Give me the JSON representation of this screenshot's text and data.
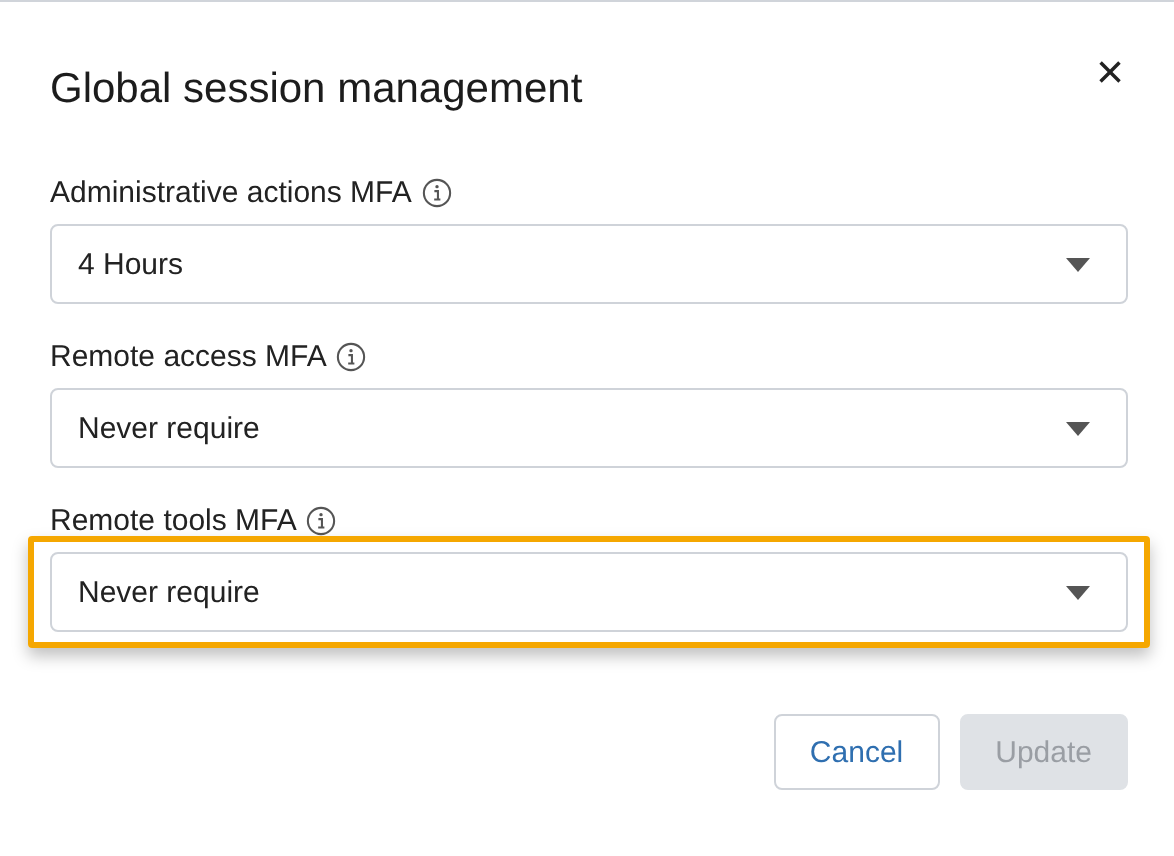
{
  "dialog": {
    "title": "Global session management",
    "close": "×"
  },
  "fields": [
    {
      "label": "Administrative actions MFA",
      "value": "4 Hours",
      "highlighted": false
    },
    {
      "label": "Remote access MFA",
      "value": "Never require",
      "highlighted": false
    },
    {
      "label": "Remote tools MFA",
      "value": "Never require",
      "highlighted": true
    }
  ],
  "buttons": [
    {
      "label": "Cancel",
      "kind": "secondary",
      "disabled": false
    },
    {
      "label": "Update",
      "kind": "primary",
      "disabled": true
    }
  ]
}
